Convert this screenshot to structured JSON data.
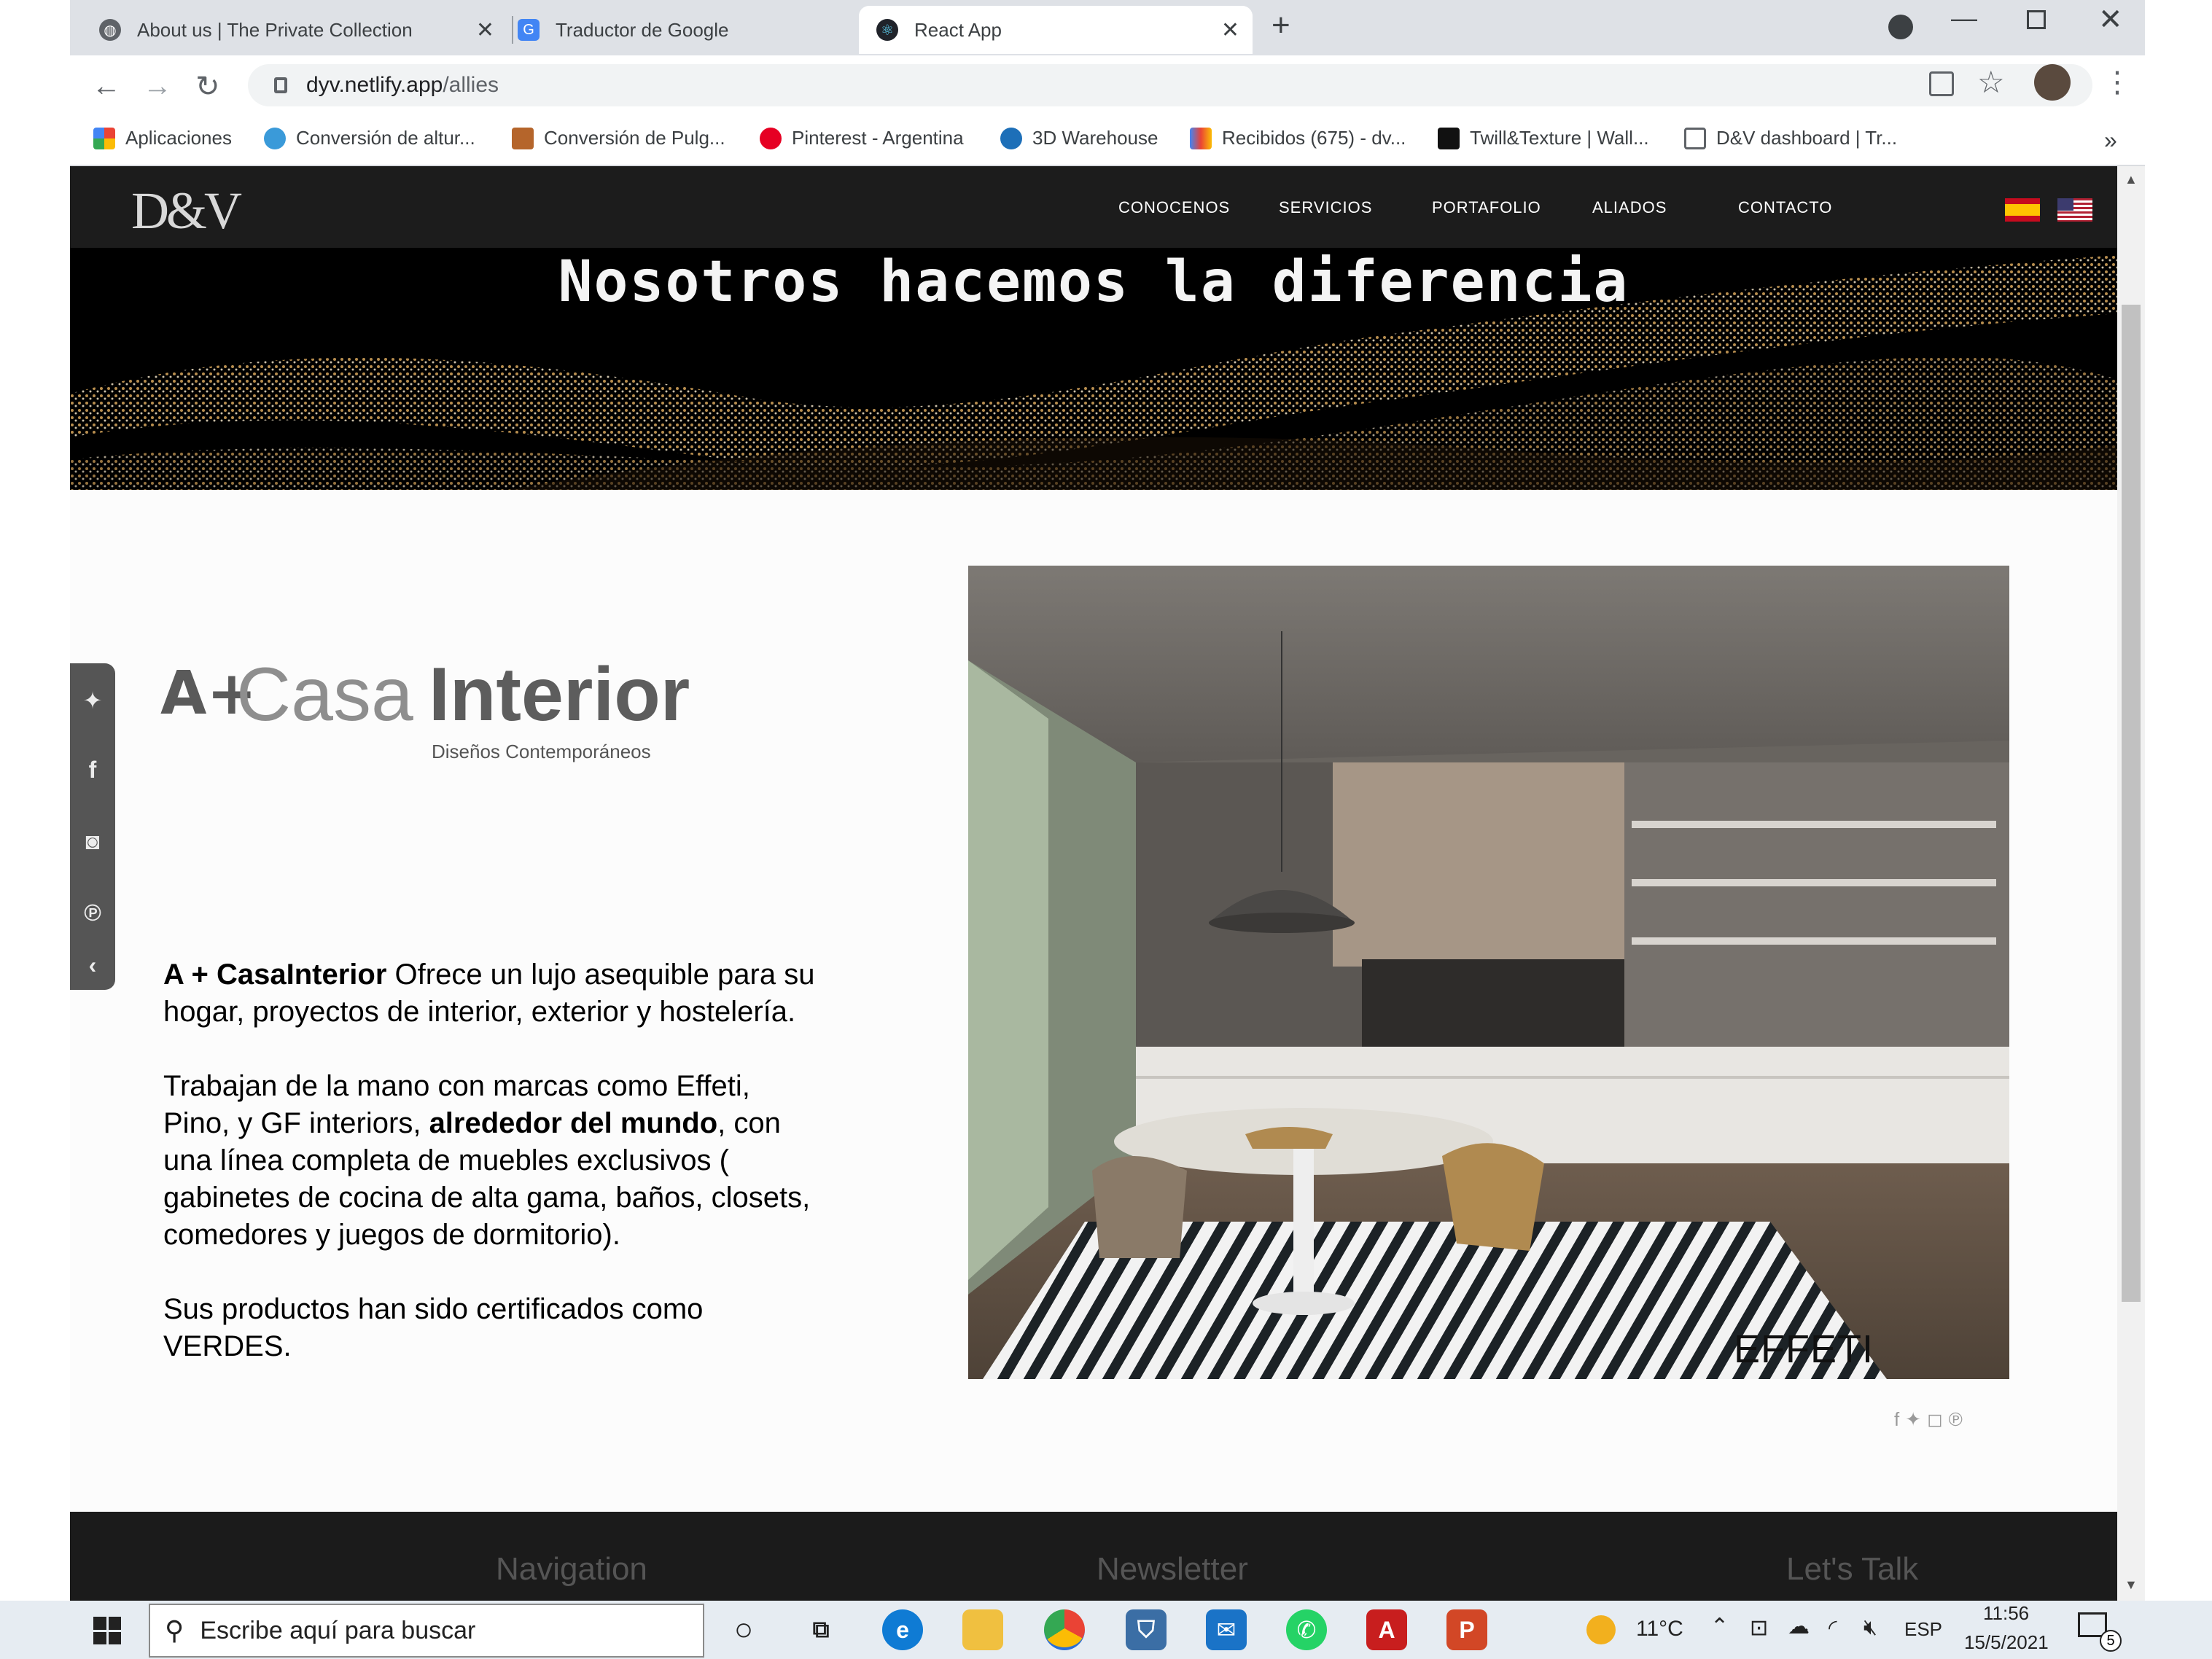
{
  "browser": {
    "tabs": [
      {
        "title": "About us | The Private Collection"
      },
      {
        "title": "Traductor de Google"
      },
      {
        "title": "React App"
      }
    ],
    "new_tab": "+",
    "url_host": "dyv.netlify.app",
    "url_path": "/allies",
    "bookmarks": [
      {
        "label": "Aplicaciones"
      },
      {
        "label": "Conversión de altur..."
      },
      {
        "label": "Conversión de Pulg..."
      },
      {
        "label": "Pinterest - Argentina"
      },
      {
        "label": "3D Warehouse"
      },
      {
        "label": "Recibidos (675) - dv..."
      },
      {
        "label": "Twill&Texture | Wall..."
      },
      {
        "label": "D&V dashboard | Tr..."
      }
    ],
    "bookmarks_more": "»"
  },
  "site": {
    "logo": "D&V",
    "nav": [
      "CONOCENOS",
      "SERVICIOS",
      "PORTAFOLIO",
      "ALIADOS",
      "CONTACTO"
    ],
    "hero_title": "Nosotros hacemos la diferencia",
    "brand": {
      "logo_prefix": "A+",
      "logo_casa": "Casa",
      "logo_interior": "Interior",
      "logo_sub": "Diseños Contemporáneos",
      "p1_bold": "A + CasaInterior",
      "p1_rest": " Ofrece un lujo asequible para su hogar, proyectos de interior, exterior y hostelería.",
      "p2_a": "Trabajan de la mano con marcas como Effeti, Pino, y GF interiors, ",
      "p2_bold": "alrededor del mundo",
      "p2_b": ", con una línea completa de muebles exclusivos ( gabinetes de cocina de alta gama, baños, closets, comedores y juegos de dormitorio).",
      "p3": "Sus productos han sido certificados como VERDES.",
      "photo_caption": "EFFETI"
    },
    "footer": {
      "col1": "Navigation",
      "col2": "Newsletter",
      "col3": "Let's Talk"
    }
  },
  "taskbar": {
    "search_placeholder": "Escribe aquí para buscar",
    "temperature": "11°C",
    "language": "ESP",
    "time": "11:56",
    "date": "15/5/2021",
    "notifications": "5"
  },
  "colors": {
    "nav_bg": "#1c1c1c",
    "chrome_bg": "#dee1e6",
    "gold": "#c9a15a",
    "taskbar_bg": "#e6ecf2"
  }
}
